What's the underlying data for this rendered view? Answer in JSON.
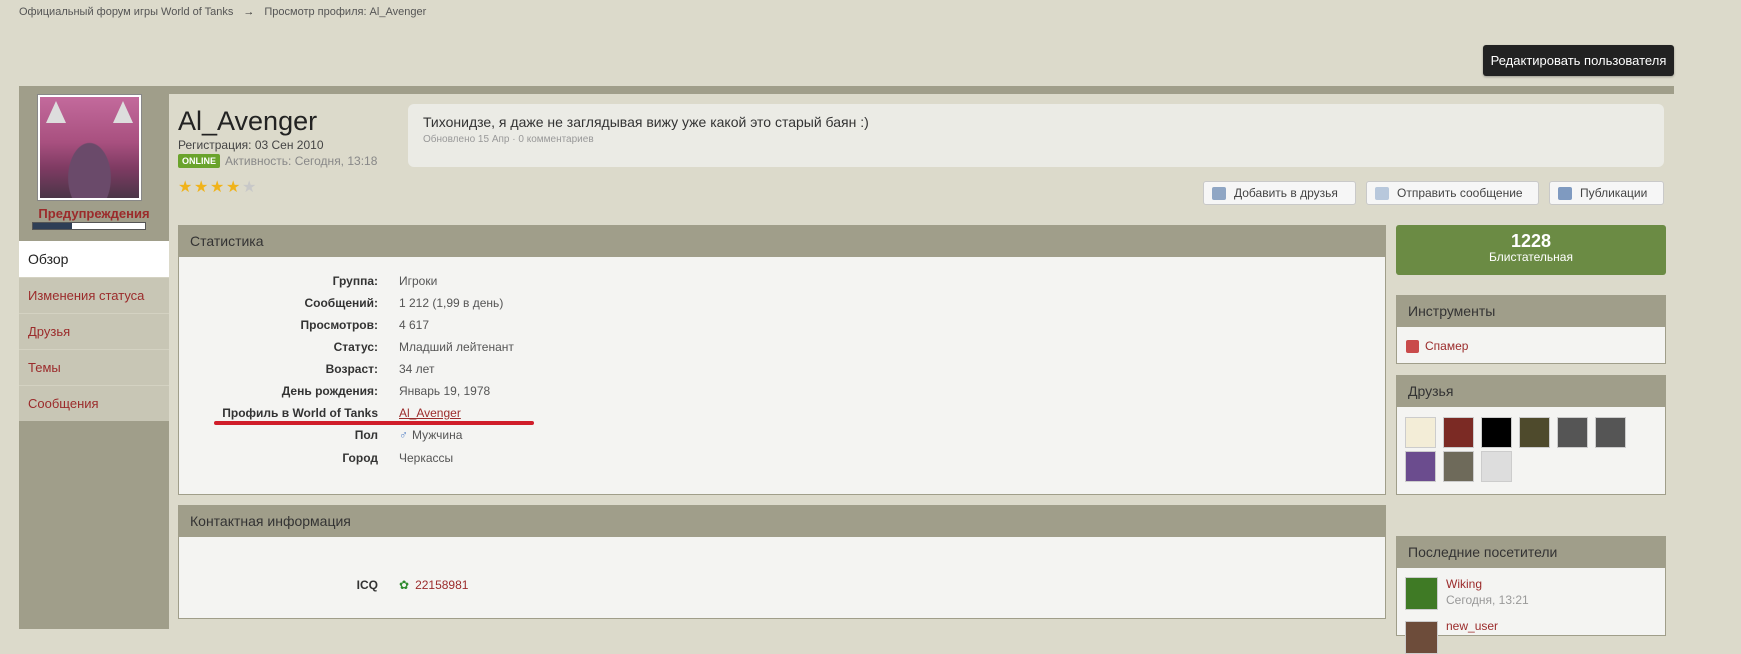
{
  "breadcrumb": {
    "items": [
      "Официальный форум игры World of Tanks",
      "Просмотр профиля: Al_Avenger"
    ],
    "separator": "→"
  },
  "header": {
    "edit_button": "Редактировать пользователя"
  },
  "sidebar": {
    "warnings_label": "Предупреждения",
    "warnings_fraction": 0.35,
    "nav": [
      "Обзор",
      "Изменения статуса",
      "Друзья",
      "Темы",
      "Сообщения"
    ]
  },
  "profile": {
    "username": "Al_Avenger",
    "registration": "Регистрация: 03 Сен 2010",
    "online_badge": "ONLINE",
    "activity": "Активность: Сегодня, 13:18",
    "rating_stars": 4,
    "rating_max": 5
  },
  "status": {
    "text": "Тихонидзе, я даже не заглядывая вижу уже какой это старый баян :)",
    "meta": "Обновлено 15 Апр · 0 комментариев"
  },
  "actions": {
    "add_friend": "Добавить в друзья",
    "send_message": "Отправить сообщение",
    "publications": "Публикации"
  },
  "stats": {
    "title": "Статистика",
    "rows": [
      {
        "label": "Группа:",
        "value": "Игроки"
      },
      {
        "label": "Сообщений:",
        "value": "1 212 (1,99 в день)"
      },
      {
        "label": "Просмотров:",
        "value": "4 617"
      },
      {
        "label": "Статус:",
        "value": "Младший лейтенант"
      },
      {
        "label": "Возраст:",
        "value": "34 лет"
      },
      {
        "label": "День рождения:",
        "value": "Январь 19, 1978"
      },
      {
        "label": "Профиль в World of Tanks",
        "value": "Al_Avenger"
      },
      {
        "label": "Пол",
        "value": "Мужчина"
      },
      {
        "label": "Город",
        "value": "Черкассы"
      }
    ]
  },
  "contact": {
    "title": "Контактная информация",
    "icq_label": "ICQ",
    "icq_value": "22158981"
  },
  "reputation": {
    "value": "1228",
    "label": "Блистательная"
  },
  "tools": {
    "title": "Инструменты",
    "spammer": "Спамер"
  },
  "friends": {
    "title": "Друзья"
  },
  "visitors": {
    "title": "Последние посетители",
    "items": [
      {
        "name": "Wiking",
        "time": "Сегодня, 13:21"
      },
      {
        "name": "new_user"
      }
    ]
  },
  "colors": {
    "accent_link": "#9b2b2b",
    "panel_header": "#a09e8a",
    "reputation_bg": "#6b8b44",
    "online_green": "#6aa32c",
    "highlight_underline": "#d01d2a"
  }
}
